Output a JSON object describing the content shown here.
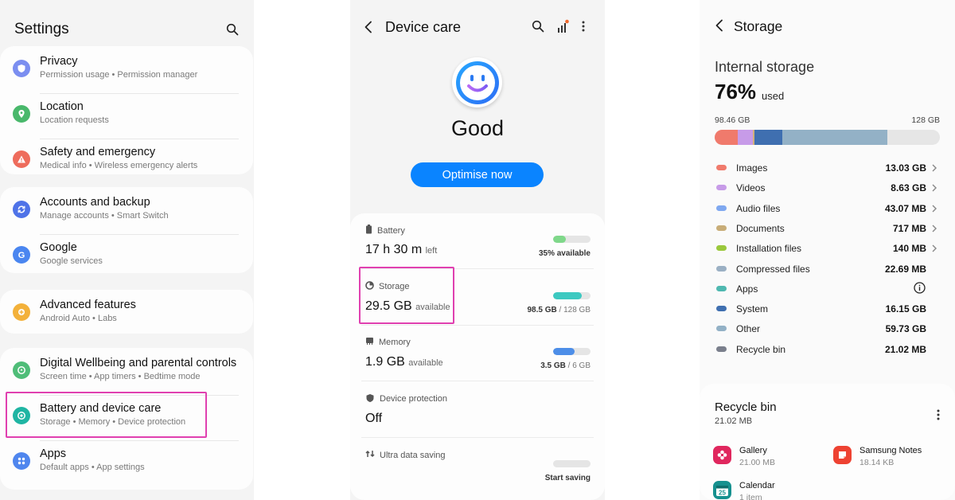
{
  "settings": {
    "title": "Settings",
    "groups": [
      [
        {
          "title": "Privacy",
          "sub": "Permission usage  •  Permission manager",
          "icon": "shield-icon",
          "color": "#7b8ef0"
        },
        {
          "title": "Location",
          "sub": "Location requests",
          "icon": "location-pin-icon",
          "color": "#49b86b"
        },
        {
          "title": "Safety and emergency",
          "sub": "Medical info  •  Wireless emergency alerts",
          "icon": "alert-icon",
          "color": "#ee6c5c"
        }
      ],
      [
        {
          "title": "Accounts and backup",
          "sub": "Manage accounts  •  Smart Switch",
          "icon": "sync-icon",
          "color": "#4f73e8"
        },
        {
          "title": "Google",
          "sub": "Google services",
          "icon": "google-icon",
          "color": "#4a86f0"
        }
      ],
      [
        {
          "title": "Advanced features",
          "sub": "Android Auto  •  Labs",
          "icon": "gear-plus-icon",
          "color": "#f3b13a"
        }
      ],
      [
        {
          "title": "Digital Wellbeing and parental controls",
          "sub": "Screen time  •  App timers  •  Bedtime mode",
          "icon": "wellbeing-icon",
          "color": "#4fbd78"
        },
        {
          "title": "Battery and device care",
          "sub": "Storage  •  Memory  •  Device protection",
          "icon": "device-care-icon",
          "color": "#1fb5a3"
        },
        {
          "title": "Apps",
          "sub": "Default apps  •  App settings",
          "icon": "apps-grid-icon",
          "color": "#4f86ee"
        }
      ]
    ]
  },
  "device_care": {
    "title": "Device care",
    "status": "Good",
    "button": "Optimise now",
    "items": [
      {
        "label": "Battery",
        "value": "17 h 30 m",
        "unit": "left",
        "cap_bold": "35% available",
        "cap_rest": "",
        "fill": 0.35,
        "color": "#7fd88a",
        "icon": "battery-icon"
      },
      {
        "label": "Storage",
        "value": "29.5 GB",
        "unit": "available",
        "cap_bold": "98.5 GB",
        "cap_rest": " / 128 GB",
        "fill": 0.77,
        "color": "#3cc9c1",
        "icon": "storage-pie-icon"
      },
      {
        "label": "Memory",
        "value": "1.9 GB",
        "unit": "available",
        "cap_bold": "3.5 GB",
        "cap_rest": " / 6 GB",
        "fill": 0.58,
        "color": "#4d8ee8",
        "icon": "memory-chip-icon"
      },
      {
        "label": "Device protection",
        "value": "Off",
        "unit": "",
        "cap_bold": "",
        "cap_rest": "",
        "fill": null,
        "color": "",
        "icon": "shield-icon"
      },
      {
        "label": "Ultra data saving",
        "value": "",
        "unit": "",
        "cap_bold": "Start saving",
        "cap_rest": "",
        "fill": 0,
        "color": "",
        "icon": "data-saving-icon"
      }
    ]
  },
  "storage": {
    "title": "Storage",
    "internal_title": "Internal storage",
    "percent": "76%",
    "used_label": "used",
    "used_total": "98.46 GB",
    "capacity": "128 GB",
    "bar_segments": [
      {
        "name": "Images",
        "fraction": 0.102,
        "color": "#f07a6c"
      },
      {
        "name": "Videos",
        "fraction": 0.067,
        "color": "#c79be8"
      },
      {
        "name": "Documents",
        "fraction": 0.006,
        "color": "#d2b07a"
      },
      {
        "name": "System",
        "fraction": 0.126,
        "color": "#3f6fb0"
      },
      {
        "name": "Other",
        "fraction": 0.467,
        "color": "#93b1c6"
      }
    ],
    "categories": [
      {
        "name": "Images",
        "size": "13.03 GB",
        "color": "#f07a6c",
        "chevron": true
      },
      {
        "name": "Videos",
        "size": "8.63 GB",
        "color": "#c79be8",
        "chevron": true
      },
      {
        "name": "Audio files",
        "size": "43.07 MB",
        "color": "#7fa8f0",
        "chevron": true
      },
      {
        "name": "Documents",
        "size": "717 MB",
        "color": "#c8ad78",
        "chevron": true
      },
      {
        "name": "Installation files",
        "size": "140 MB",
        "color": "#9ac83c",
        "chevron": true
      },
      {
        "name": "Compressed files",
        "size": "22.69 MB",
        "color": "#9bb0c4",
        "chevron": false
      },
      {
        "name": "Apps",
        "size": "",
        "color": "#4fb8b0",
        "chevron": false,
        "info": true
      },
      {
        "name": "System",
        "size": "16.15 GB",
        "color": "#3f6fb0",
        "chevron": false
      },
      {
        "name": "Other",
        "size": "59.73 GB",
        "color": "#93b1c6",
        "chevron": false
      },
      {
        "name": "Recycle bin",
        "size": "21.02 MB",
        "color": "#7a7f8c",
        "chevron": false
      }
    ],
    "recycle": {
      "title": "Recycle bin",
      "size": "21.02 MB",
      "apps": [
        {
          "name": "Gallery",
          "size": "21.00 MB",
          "icon": "gallery-flower-icon",
          "color": "#e0275e"
        },
        {
          "name": "Samsung Notes",
          "size": "18.14 KB",
          "icon": "notes-icon",
          "color": "#ee4232"
        },
        {
          "name": "Calendar",
          "size": "1 item",
          "icon": "calendar-icon",
          "color": "#16918f",
          "badge": "25"
        }
      ]
    }
  }
}
